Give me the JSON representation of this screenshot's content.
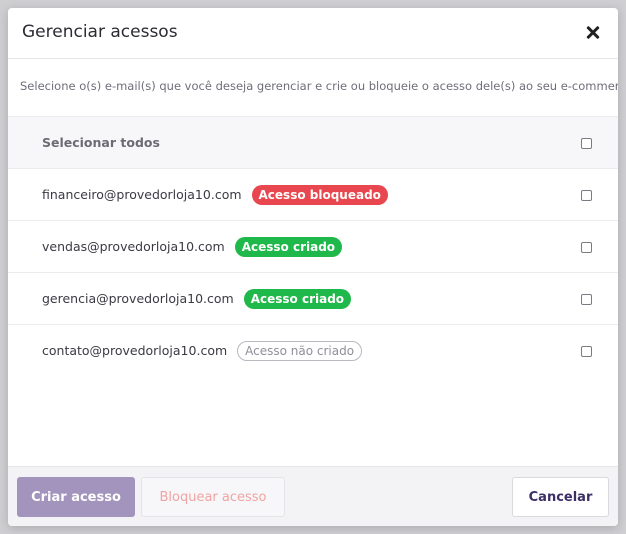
{
  "modal": {
    "title": "Gerenciar acessos",
    "description": "Selecione o(s) e-mail(s) que você deseja gerenciar e crie ou bloqueie o acesso dele(s) ao seu e-commerce."
  },
  "list": {
    "select_all_label": "Selecionar todos",
    "items": [
      {
        "email": "financeiro@provedorloja10.com",
        "status": "Acesso bloqueado"
      },
      {
        "email": "vendas@provedorloja10.com",
        "status": "Acesso criado"
      },
      {
        "email": "gerencia@provedorloja10.com",
        "status": "Acesso criado"
      },
      {
        "email": "contato@provedorloja10.com",
        "status": "Acesso não criado"
      }
    ]
  },
  "footer": {
    "create_label": "Criar acesso",
    "block_label": "Bloquear acesso",
    "cancel_label": "Cancelar"
  },
  "colors": {
    "blocked": "#e8474f",
    "created": "#1fb84a",
    "not_created": "#b8b8bf",
    "primary_button": "#a394be",
    "cancel_text": "#3b2f66"
  }
}
